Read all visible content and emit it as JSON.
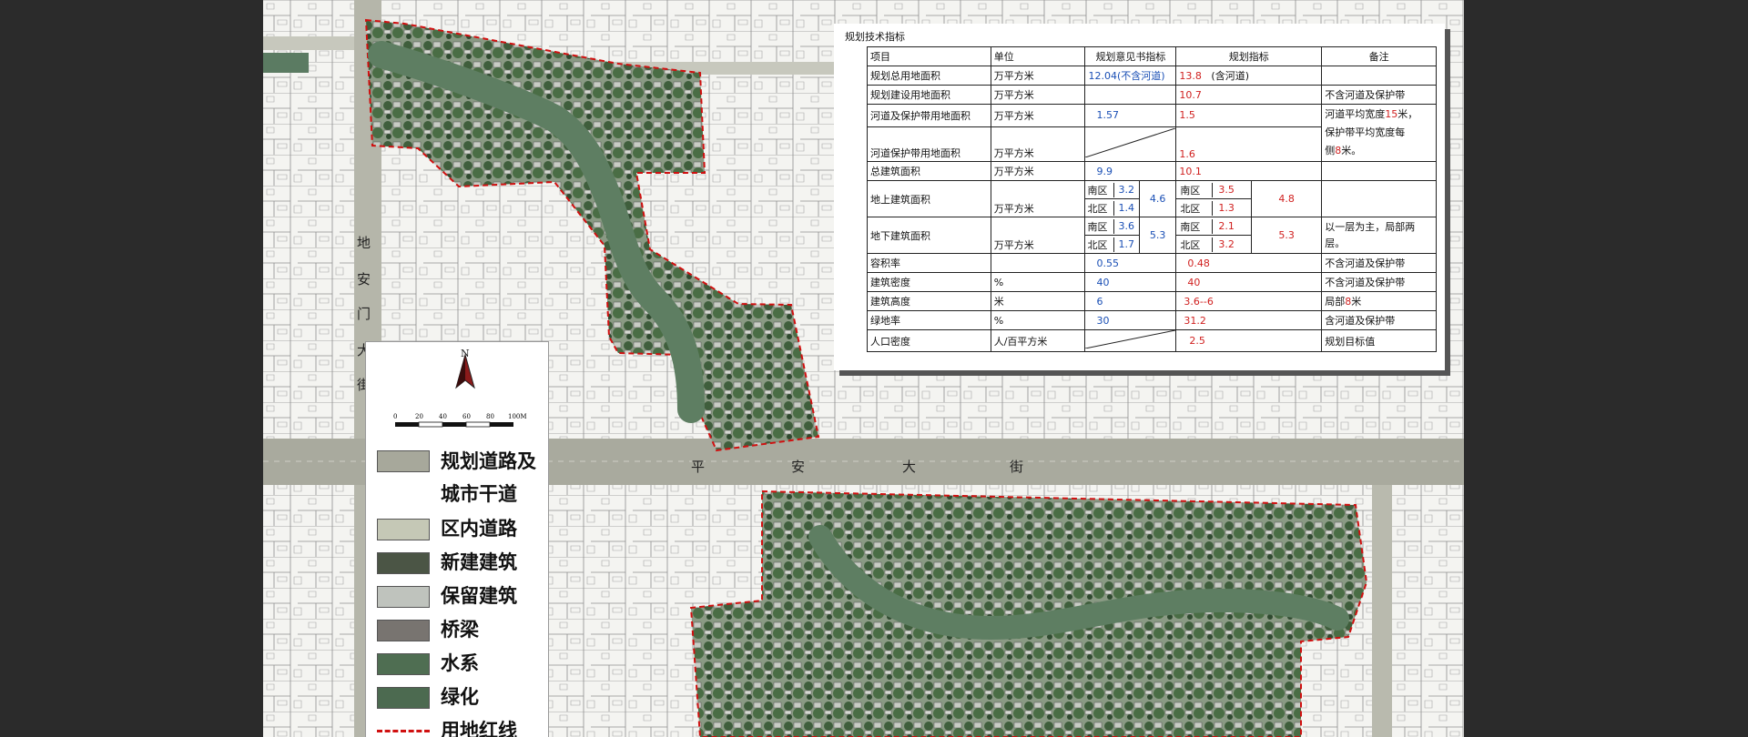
{
  "streets": {
    "main_chars": [
      "平",
      "安",
      "大",
      "街"
    ],
    "vertical_chars": [
      "地",
      "安",
      "门",
      "大",
      "街"
    ]
  },
  "legend": {
    "north": "N",
    "scale_labels": [
      "0",
      "20",
      "40",
      "60",
      "80",
      "100M"
    ],
    "items": [
      {
        "label": "规划道路及城市干道",
        "color": "#a7a89b"
      },
      {
        "label": "区内道路",
        "color": "#c5c8b6"
      },
      {
        "label": "新建建筑",
        "color": "#4b5545"
      },
      {
        "label": "保留建筑",
        "color": "#bfc3bd"
      },
      {
        "label": "桥梁",
        "color": "#787470"
      },
      {
        "label": "水系",
        "color": "#4f6e52"
      },
      {
        "label": "绿化",
        "color": "#4c6a50"
      },
      {
        "label": "用地红线",
        "color": "#d01010"
      }
    ]
  },
  "tech": {
    "title": "规划技术指标",
    "headers": [
      "项目",
      "单位",
      "规划意见书指标",
      "规划指标",
      "备注"
    ],
    "rows": {
      "r1": {
        "item": "规划总用地面积",
        "unit": "万平方米",
        "opinion": "12.04(不含河道)",
        "plan": "13.8",
        "plan_note": "(含河道)",
        "note": ""
      },
      "r2": {
        "item": "规划建设用地面积",
        "unit": "万平方米",
        "opinion": "",
        "plan": "10.7",
        "note": "不含河道及保护带"
      },
      "r3": {
        "item": "河道及保护带用地面积",
        "unit": "万平方米",
        "opinion": "1.57",
        "plan": "1.5",
        "note_a": "河道平均宽度",
        "note_b": "15",
        "note_c": "米，",
        "note_d": "保护带平均宽度每",
        "note_e": "侧",
        "note_f": "8",
        "note_g": "米。"
      },
      "r4": {
        "item": "河道保护带用地面积",
        "unit": "万平方米",
        "plan": "1.6"
      },
      "r5": {
        "item": "总建筑面积",
        "unit": "万平方米",
        "opinion": "9.9",
        "plan": "10.1"
      },
      "r6": {
        "item": "地上建筑面积",
        "unit": "万平方米",
        "south": "南区",
        "north": "北区",
        "op_s": "3.2",
        "op_n": "1.4",
        "op_t": "4.6",
        "pl_s": "3.5",
        "pl_n": "1.3",
        "pl_t": "4.8"
      },
      "r7": {
        "item": "地下建筑面积",
        "unit": "万平方米",
        "south": "南区",
        "north": "北区",
        "op_s": "3.6",
        "op_n": "1.7",
        "op_t": "5.3",
        "pl_s": "2.1",
        "pl_n": "3.2",
        "pl_t": "5.3",
        "note": "以一层为主，局部两层。"
      },
      "r8": {
        "item": "容积率",
        "unit": "",
        "opinion": "0.55",
        "plan": "0.48",
        "note": "不含河道及保护带"
      },
      "r9": {
        "item": "建筑密度",
        "unit": "%",
        "opinion": "40",
        "plan": "40",
        "note": "不含河道及保护带"
      },
      "r10": {
        "item": "建筑高度",
        "unit": "米",
        "opinion": "6",
        "plan": "3.6--6",
        "note_a": "局部",
        "note_b": "8",
        "note_c": "米"
      },
      "r11": {
        "item": "绿地率",
        "unit": "%",
        "opinion": "30",
        "plan": "31.2",
        "note": "含河道及保护带"
      },
      "r12": {
        "item": "人口密度",
        "unit": "人/百平方米",
        "opinion": "",
        "plan": "2.5",
        "note": "规划目标值"
      }
    }
  }
}
